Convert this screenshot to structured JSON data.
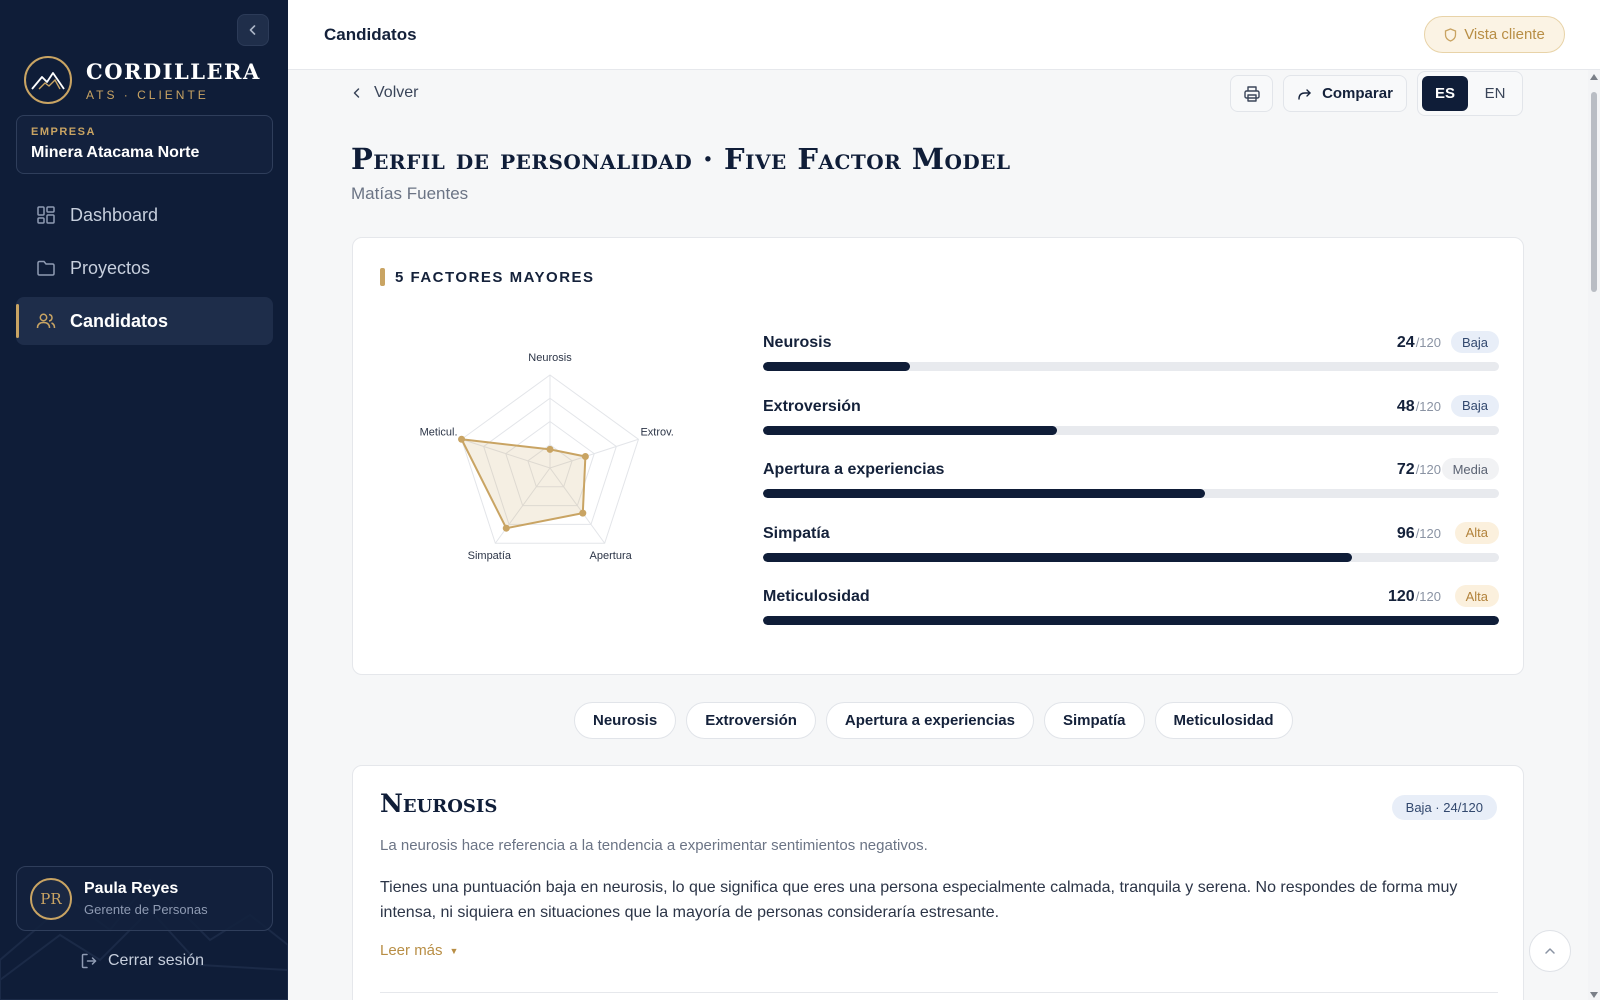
{
  "brand": {
    "name": "CORDILLERA",
    "sub": "ATS · CLIENTE",
    "accent": "#c9a463",
    "navy": "#0f1d38"
  },
  "company": {
    "label": "EMPRESA",
    "name": "Minera Atacama Norte"
  },
  "sidebar": {
    "items": [
      {
        "label": "Dashboard",
        "icon": "grid-icon",
        "active": false
      },
      {
        "label": "Proyectos",
        "icon": "folder-icon",
        "active": false
      },
      {
        "label": "Candidatos",
        "icon": "users-icon",
        "active": true
      }
    ]
  },
  "user": {
    "initials": "PR",
    "name": "Paula Reyes",
    "role": "Gerente de Personas"
  },
  "logout_label": "Cerrar sesión",
  "topbar": {
    "title": "Candidatos",
    "client_view": "Vista cliente"
  },
  "toolbar": {
    "back": "Volver",
    "compare": "Comparar",
    "lang_es": "ES",
    "lang_en": "EN"
  },
  "page": {
    "title": "Perfil de personalidad · Five Factor Model",
    "candidate": "Matías Fuentes"
  },
  "factors": {
    "section_title": "5 FACTORES MAYORES",
    "max": 120,
    "items": [
      {
        "name": "Neurosis",
        "score": "24",
        "max_label": "/120",
        "level": "Baja",
        "value": 24
      },
      {
        "name": "Extroversión",
        "score": "48",
        "max_label": "/120",
        "level": "Baja",
        "value": 48
      },
      {
        "name": "Apertura a experiencias",
        "score": "72",
        "max_label": "/120",
        "level": "Media",
        "value": 72
      },
      {
        "name": "Simpatía",
        "score": "96",
        "max_label": "/120",
        "level": "Alta",
        "value": 96
      },
      {
        "name": "Meticulosidad",
        "score": "120",
        "max_label": "/120",
        "level": "Alta",
        "value": 120
      }
    ]
  },
  "chart_data": {
    "type": "radar",
    "axes": [
      "Neurosis",
      "Extrov.",
      "Apertura",
      "Simpatía",
      "Meticul."
    ],
    "values": [
      24,
      48,
      72,
      96,
      120
    ],
    "range": [
      0,
      120
    ],
    "rings": 4,
    "series_color": "#c9a463"
  },
  "tabs": [
    "Neurosis",
    "Extroversión",
    "Apertura a experiencias",
    "Simpatía",
    "Meticulosidad"
  ],
  "detail": {
    "title": "Neurosis",
    "badge": "Baja · 24/120",
    "intro": "La neurosis hace referencia a la tendencia a experimentar sentimientos negativos.",
    "body": "Tienes una puntuación baja en neurosis, lo que significa que eres una persona especialmente calmada, tranquila y serena. No respondes de forma muy intensa, ni siquiera en situaciones que la mayoría de personas consideraría estresante.",
    "read_more": "Leer más"
  }
}
